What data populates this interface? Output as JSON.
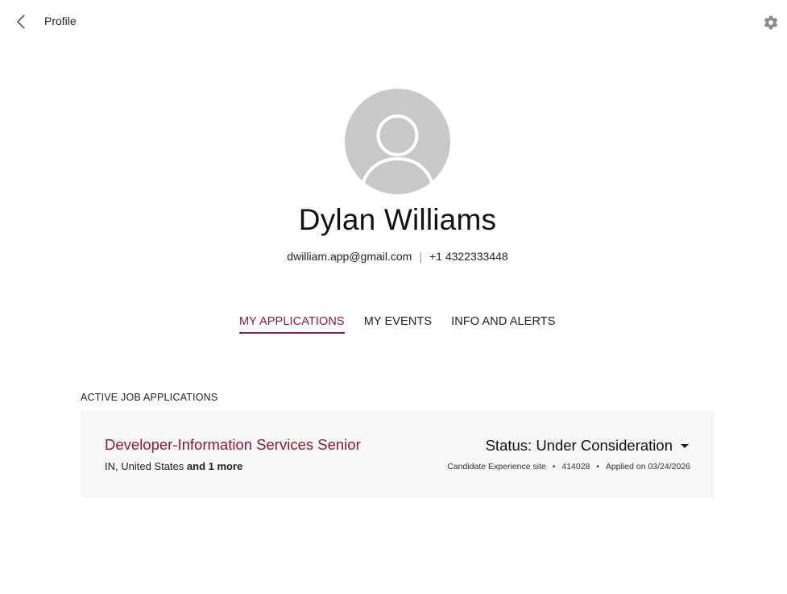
{
  "header": {
    "back_icon": "chevron-left-icon",
    "title": "Profile",
    "settings_icon": "gear-icon"
  },
  "profile": {
    "avatar_icon": "user-avatar-icon",
    "name": "Dylan Williams",
    "email": "dwilliam.app@gmail.com",
    "separator": "|",
    "phone": "+1 4322333448"
  },
  "tabs": [
    {
      "label": "MY APPLICATIONS",
      "active": true
    },
    {
      "label": "MY EVENTS",
      "active": false
    },
    {
      "label": "INFO AND ALERTS",
      "active": false
    }
  ],
  "applications": {
    "section_label": "ACTIVE JOB APPLICATIONS",
    "items": [
      {
        "title": "Developer-Information Services Senior",
        "location": "IN, United States",
        "location_more": "and 1 more",
        "status": "Status: Under Consideration",
        "site": "Candidate Experience site",
        "meta_dot": "•",
        "job_id": "414028",
        "applied": "Applied on 03/24/2026"
      }
    ]
  },
  "colors": {
    "accent": "#8a1c36",
    "card_bg": "#f7f7f7",
    "avatar_bg": "#c8c8c8"
  }
}
